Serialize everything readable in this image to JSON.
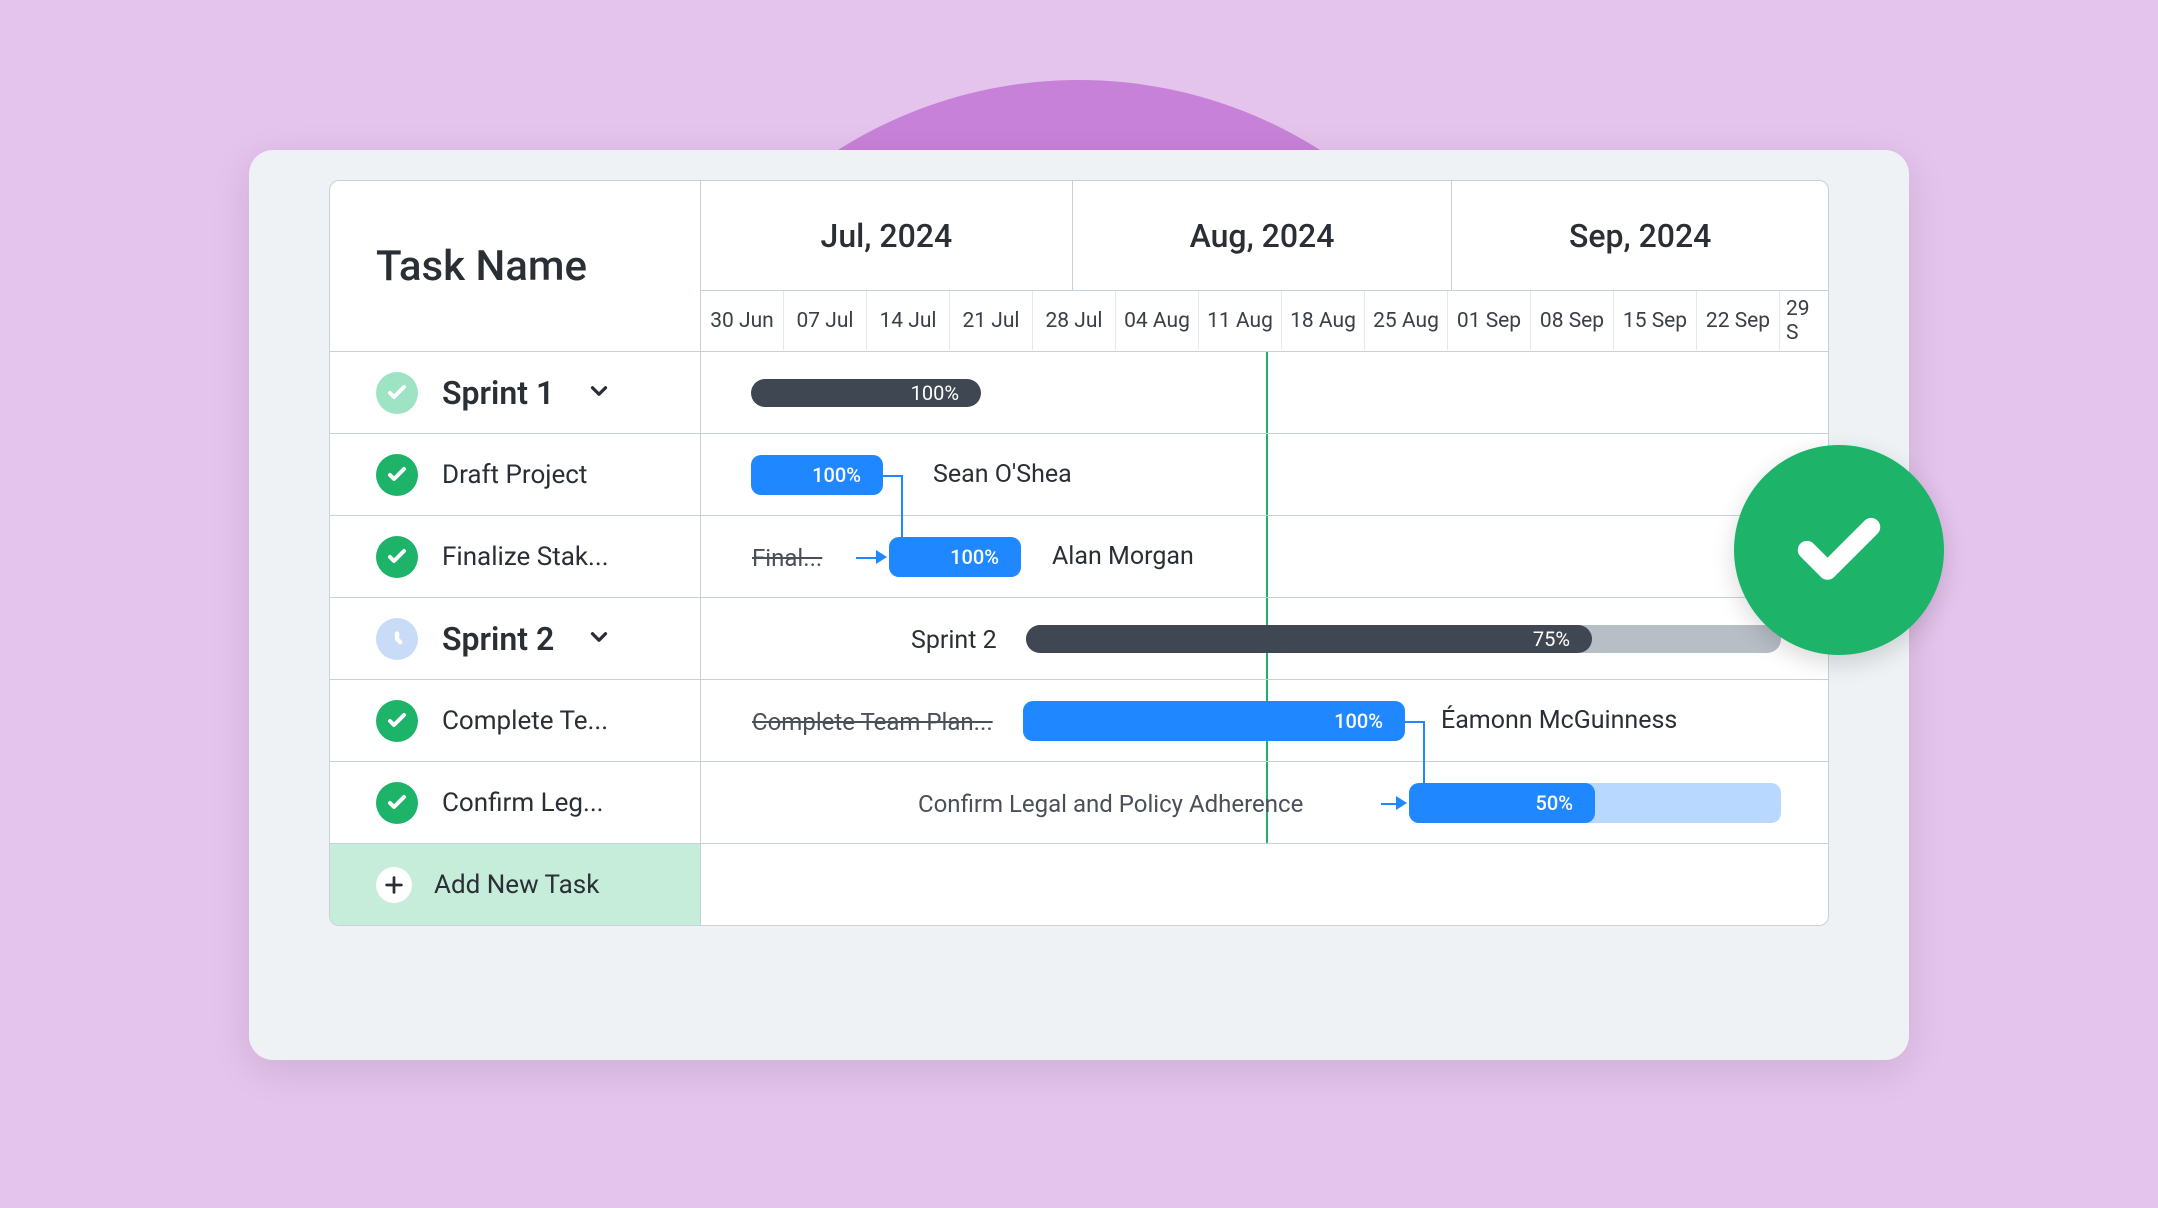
{
  "header": {
    "task_name": "Task Name"
  },
  "timeline": {
    "months": [
      {
        "label": "Jul, 2024",
        "span": 5
      },
      {
        "label": "Aug, 2024",
        "span": 4
      },
      {
        "label": "Sep, 2024",
        "span": 5
      }
    ],
    "weeks": [
      "30 Jun",
      "07 Jul",
      "14 Jul",
      "21 Jul",
      "28 Jul",
      "04 Aug",
      "11 Aug",
      "18 Aug",
      "25 Aug",
      "01 Sep",
      "08 Sep",
      "15 Sep",
      "22 Sep",
      "29 S"
    ]
  },
  "sprint1": {
    "name": "Sprint 1",
    "progress": "100%",
    "task1": {
      "name": "Draft Project",
      "progress": "100%",
      "assignee": "Sean O'Shea"
    },
    "task2": {
      "name": "Finalize Stak...",
      "link_label": "Final...",
      "progress": "100%",
      "assignee": "Alan Morgan"
    }
  },
  "sprint2": {
    "name": "Sprint 2",
    "label_in_chart": "Sprint 2",
    "progress": "75%",
    "task1": {
      "name": "Complete Te...",
      "link_label": "Complete Team Plan...",
      "progress": "100%",
      "assignee": "Éamonn McGuinness"
    },
    "task2": {
      "name": "Confirm Leg...",
      "link_label": "Confirm Legal and Policy Adherence",
      "progress": "50%"
    }
  },
  "add_label": "Add New Task",
  "chart_data": {
    "type": "gantt",
    "x_unit": "week_index_from_30_jun_2024",
    "today_marker": 6.7,
    "rows": [
      {
        "kind": "summary",
        "name": "Sprint 1",
        "start": 0.45,
        "end": 3.7,
        "progress_pct": 100
      },
      {
        "kind": "task",
        "name": "Draft Project",
        "start": 0.45,
        "end": 2.2,
        "progress_pct": 100,
        "assignee": "Sean O'Shea"
      },
      {
        "kind": "task",
        "name": "Finalize Stakeholders",
        "start": 2.0,
        "end": 3.7,
        "progress_pct": 100,
        "assignee": "Alan Morgan",
        "depends_on": "Draft Project"
      },
      {
        "kind": "summary",
        "name": "Sprint 2",
        "start": 3.9,
        "end": 12.9,
        "progress_pct": 75
      },
      {
        "kind": "task",
        "name": "Complete Team Plan",
        "start": 3.85,
        "end": 8.4,
        "progress_pct": 100,
        "assignee": "Éamonn McGuinness"
      },
      {
        "kind": "task",
        "name": "Confirm Legal and Policy Adherence",
        "start": 8.4,
        "end": 12.9,
        "progress_pct": 50,
        "depends_on": "Complete Team Plan"
      }
    ]
  }
}
